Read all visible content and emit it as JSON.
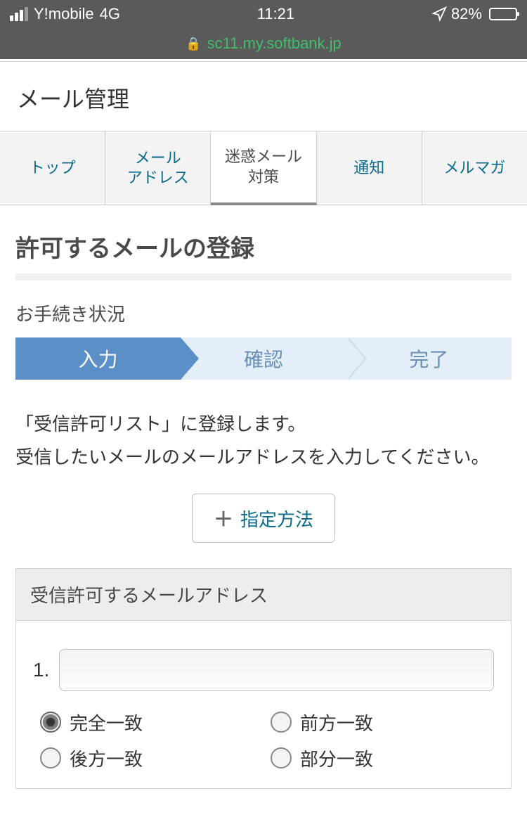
{
  "status": {
    "carrier": "Y!mobile",
    "network": "4G",
    "time": "11:21",
    "battery": "82%"
  },
  "url": "sc11.my.softbank.jp",
  "pageTitle": "メール管理",
  "tabs": {
    "top": "トップ",
    "address": "メール\nアドレス",
    "spam": "迷惑メール\n対策",
    "notice": "通知",
    "mag": "メルマガ"
  },
  "sectionTitle": "許可するメールの登録",
  "procedureLabel": "お手続き状況",
  "steps": {
    "input": "入力",
    "confirm": "確認",
    "done": "完了"
  },
  "description": "「受信許可リスト」に登録します。\n受信したいメールのメールアドレスを入力してください。",
  "methodButton": "指定方法",
  "panel": {
    "heading": "受信許可するメールアドレス",
    "rowNum": "1.",
    "radios": {
      "exact": "完全一致",
      "forward": "前方一致",
      "backward": "後方一致",
      "partial": "部分一致"
    }
  }
}
